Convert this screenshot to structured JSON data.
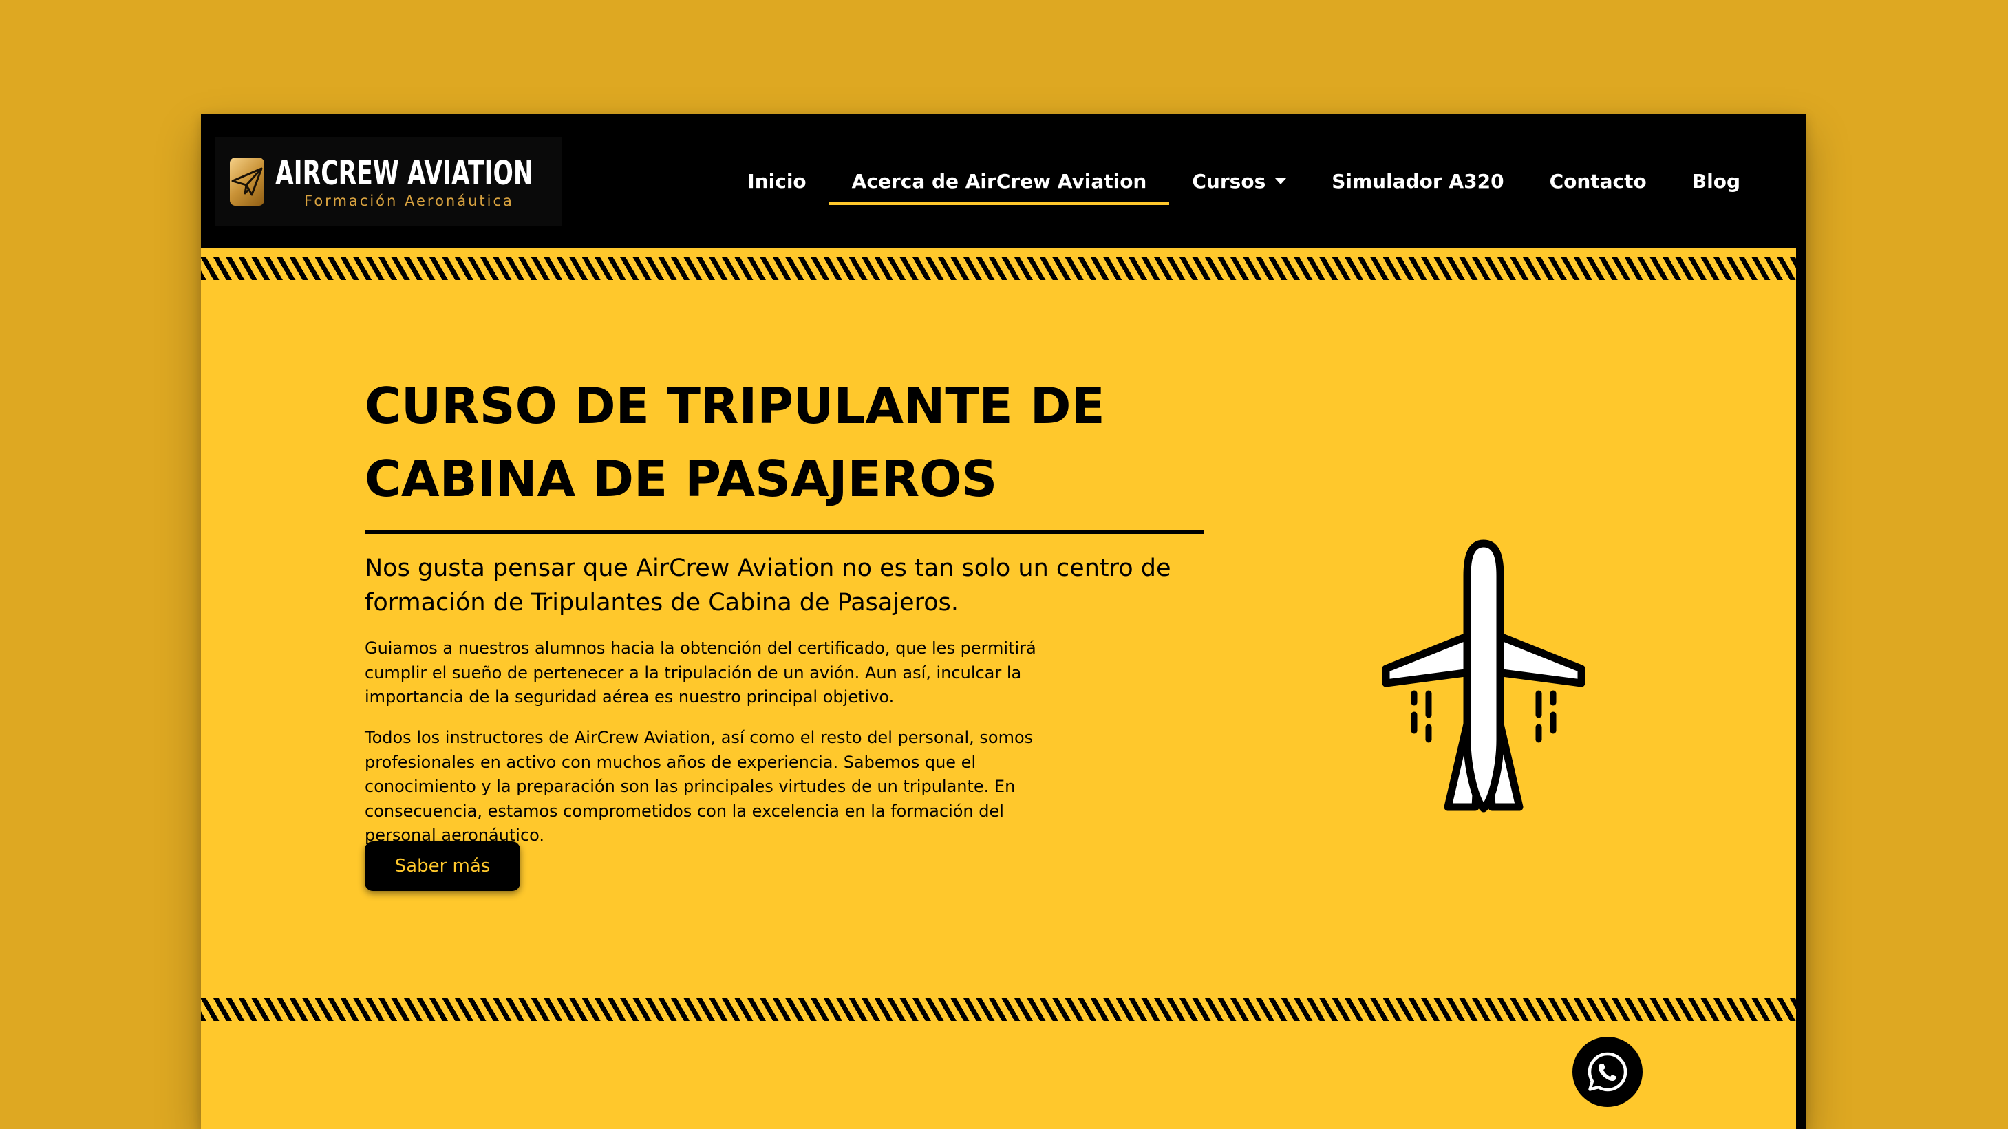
{
  "brand": {
    "name": "AIRCREW AVIATION",
    "tagline": "Formación Aeronáutica",
    "logo_icon": "paper-plane-icon"
  },
  "nav": {
    "items": [
      {
        "label": "Inicio",
        "active": false
      },
      {
        "label": "Acerca de AirCrew Aviation",
        "active": true
      },
      {
        "label": "Cursos",
        "active": false,
        "has_dropdown": true
      },
      {
        "label": "Simulador A320",
        "active": false
      },
      {
        "label": "Contacto",
        "active": false
      },
      {
        "label": "Blog",
        "active": false
      }
    ]
  },
  "hero": {
    "title_line1": "CURSO DE TRIPULANTE DE",
    "title_line2": "CABINA DE PASAJEROS",
    "lead": "Nos gusta pensar que AirCrew Aviation no es tan solo un centro de formación de Tripulantes de Cabina de Pasajeros.",
    "paragraph1": "Guiamos a nuestros alumnos hacia la obtención del certificado, que les permitirá cumplir el sueño de pertenecer a la tripulación de un avión. Aun así, inculcar la importancia de la seguridad aérea es nuestro principal objetivo.",
    "paragraph2": "Todos los instructores de AirCrew Aviation, así como el resto del personal, somos profesionales en activo con muchos años de experiencia. Sabemos que el conocimiento y la preparación son las principales virtudes de un tripulante. En consecuencia, estamos comprometidos con la excelencia en la formación del personal aeronáutico.",
    "button_label": "Saber más",
    "illustration": "airplane-icon"
  },
  "floating": {
    "icon": "whatsapp-icon"
  },
  "colors": {
    "accent": "#FFC82C",
    "backdrop": "#DEA822",
    "header": "#000000",
    "text": "#000000"
  }
}
